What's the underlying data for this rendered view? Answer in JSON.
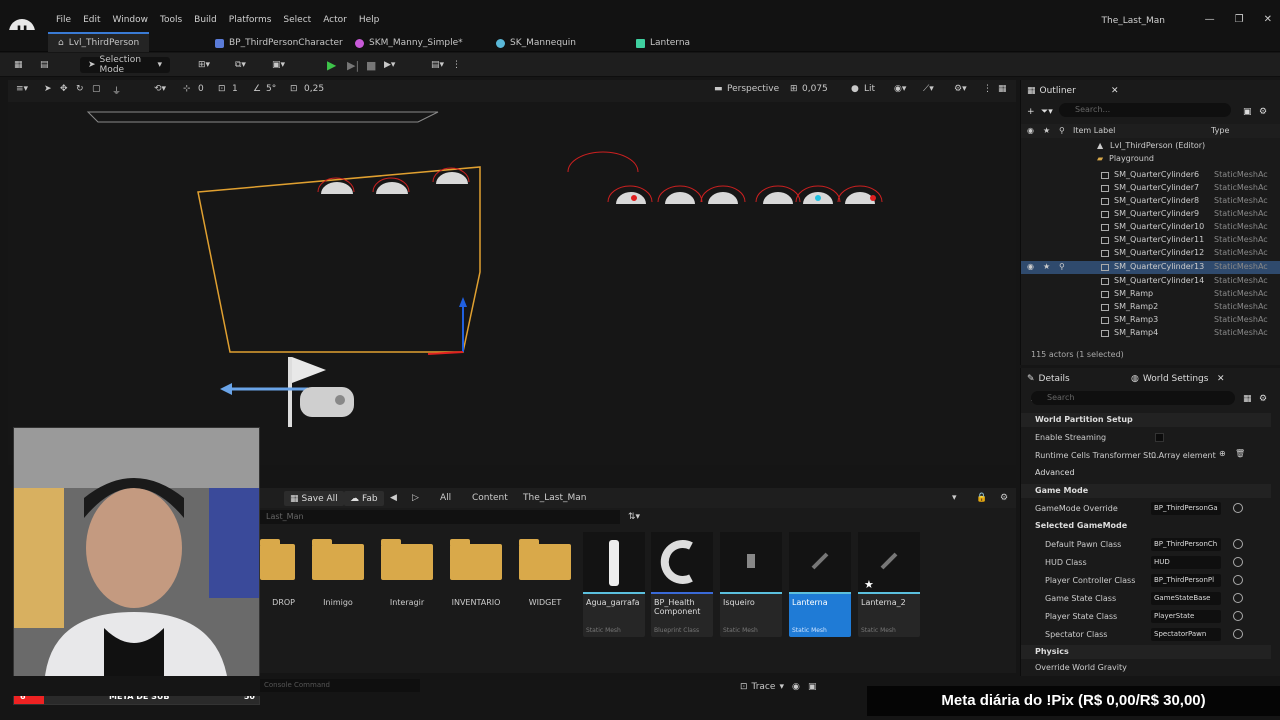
{
  "app": {
    "project_title": "The_Last_Man",
    "menu": [
      "File",
      "Edit",
      "Window",
      "Tools",
      "Build",
      "Platforms",
      "Select",
      "Actor",
      "Help"
    ]
  },
  "tabs": [
    {
      "label": "Lvl_ThirdPerson"
    },
    {
      "label": "BP_ThirdPersonCharacter"
    },
    {
      "label": "SKM_Manny_Simple*"
    },
    {
      "label": "SK_Mannequin"
    },
    {
      "label": "Lanterna"
    }
  ],
  "toolbar": {
    "selection_mode": "Selection Mode"
  },
  "viewport": {
    "perspective": "Perspective",
    "lit": "Lit",
    "snap_values": [
      "0",
      "1",
      "5°",
      "0,25"
    ],
    "camera_speed": "0,075"
  },
  "outliner": {
    "title": "Outliner",
    "search_placeholder": "Search...",
    "col_label": "Item Label",
    "col_type": "Type",
    "level": "Lvl_ThirdPerson (Editor)",
    "folder": "Playground",
    "rows": [
      {
        "name": "SM_QuarterCylinder6",
        "type": "StaticMeshAc"
      },
      {
        "name": "SM_QuarterCylinder7",
        "type": "StaticMeshAc"
      },
      {
        "name": "SM_QuarterCylinder8",
        "type": "StaticMeshAc"
      },
      {
        "name": "SM_QuarterCylinder9",
        "type": "StaticMeshAc"
      },
      {
        "name": "SM_QuarterCylinder10",
        "type": "StaticMeshAc"
      },
      {
        "name": "SM_QuarterCylinder11",
        "type": "StaticMeshAc"
      },
      {
        "name": "SM_QuarterCylinder12",
        "type": "StaticMeshAc"
      },
      {
        "name": "SM_QuarterCylinder13",
        "type": "StaticMeshAc"
      },
      {
        "name": "SM_QuarterCylinder14",
        "type": "StaticMeshAc"
      },
      {
        "name": "SM_Ramp",
        "type": "StaticMeshAc"
      },
      {
        "name": "SM_Ramp2",
        "type": "StaticMeshAc"
      },
      {
        "name": "SM_Ramp3",
        "type": "StaticMeshAc"
      },
      {
        "name": "SM_Ramp4",
        "type": "StaticMeshAc"
      }
    ],
    "actor_count": "115 actors (1 selected)"
  },
  "details": {
    "tab_details": "Details",
    "tab_world": "World Settings",
    "search_placeholder": "Search",
    "sections": {
      "world_partition": "World Partition Setup",
      "advanced": "Advanced",
      "game_mode": "Game Mode",
      "selected_game_mode": "Selected GameMode",
      "physics": "Physics"
    },
    "props": {
      "enable_streaming": "Enable Streaming",
      "runtime_cells": "Runtime Cells Transformer St...",
      "runtime_cells_value": "0 Array element",
      "gamemode_override": "GameMode Override",
      "gamemode_override_value": "BP_ThirdPersonGa",
      "default_pawn": "Default Pawn Class",
      "default_pawn_value": "BP_ThirdPersonCh",
      "hud": "HUD Class",
      "hud_value": "HUD",
      "player_controller": "Player Controller Class",
      "player_controller_value": "BP_ThirdPersonPl",
      "game_state": "Game State Class",
      "game_state_value": "GameStateBase",
      "player_state": "Player State Class",
      "player_state_value": "PlayerState",
      "spectator": "Spectator Class",
      "spectator_value": "SpectatorPawn",
      "override_gravity": "Override World Gravity"
    }
  },
  "content_browser": {
    "save_all": "Save All",
    "fab": "Fab",
    "crumbs": [
      "All",
      "Content",
      "The_Last_Man"
    ],
    "path": "Last_Man",
    "folders": [
      "DROP",
      "Inimigo",
      "Interagir",
      "INVENTARIO",
      "WIDGET"
    ],
    "assets": [
      {
        "name": "Agua_garrafa",
        "type": "Static Mesh"
      },
      {
        "name": "BP_Health Component",
        "type": "Blueprint Class"
      },
      {
        "name": "Isqueiro",
        "type": "Static Mesh"
      },
      {
        "name": "Lanterna",
        "type": "Static Mesh"
      },
      {
        "name": "Lanterna_2",
        "type": "Static Mesh"
      }
    ]
  },
  "status": {
    "console": "Console Command",
    "trace": "Trace"
  },
  "overlay": {
    "pix": "Meta diária do !Pix (R$ 0,00/R$ 30,00)",
    "sub_label": "META DE SUB",
    "sub_left": "6",
    "sub_right": "50"
  }
}
